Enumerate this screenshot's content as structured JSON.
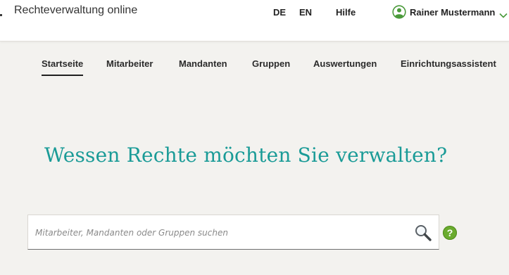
{
  "header": {
    "app_title": "Rechteverwaltung online",
    "languages": [
      "DE",
      "EN"
    ],
    "help_label": "Hilfe",
    "user_name": "Rainer Mustermann",
    "user_icon": "user-circle-icon",
    "chevron_icon": "chevron-down-icon"
  },
  "nav": {
    "tabs": [
      {
        "label": "Startseite",
        "active": true
      },
      {
        "label": "Mitarbeiter",
        "active": false
      },
      {
        "label": "Mandanten",
        "active": false
      },
      {
        "label": "Gruppen",
        "active": false
      },
      {
        "label": "Auswertungen",
        "active": false
      },
      {
        "label": "Einrichtungsassistent",
        "active": false
      }
    ]
  },
  "main": {
    "headline": "Wessen Rechte möchten Sie verwalten?",
    "search": {
      "placeholder": "Mitarbeiter, Mandanten oder Gruppen suchen",
      "value": ""
    },
    "help_icon_glyph": "?"
  },
  "colors": {
    "accent": "#1a9b97",
    "user_icon": "#4a9a3a",
    "help_icon": "#6aab2e",
    "page_background": "#f3f2ef"
  }
}
